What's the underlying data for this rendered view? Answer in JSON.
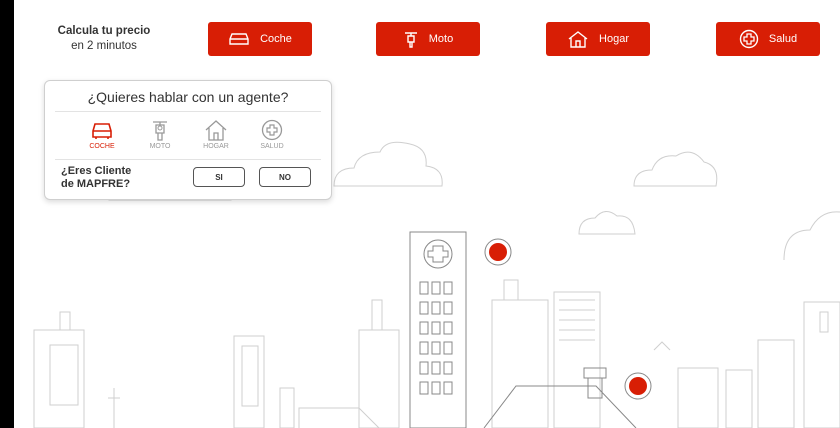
{
  "header": {
    "tagline_line1": "Calcula tu precio",
    "tagline_line2": "en 2 minutos",
    "buttons": [
      {
        "label": "Coche",
        "icon": "car-icon"
      },
      {
        "label": "Moto",
        "icon": "motorcycle-icon"
      },
      {
        "label": "Hogar",
        "icon": "house-icon"
      },
      {
        "label": "Salud",
        "icon": "health-cross-icon"
      }
    ]
  },
  "agent_panel": {
    "title": "¿Quieres hablar con un agente?",
    "products": [
      {
        "label": "COCHE",
        "icon": "car-icon",
        "active": true
      },
      {
        "label": "MOTO",
        "icon": "motorcycle-icon",
        "active": false
      },
      {
        "label": "HOGAR",
        "icon": "house-icon",
        "active": false
      },
      {
        "label": "SALUD",
        "icon": "health-cross-icon",
        "active": false
      }
    ],
    "client_question_line1": "¿Eres Cliente",
    "client_question_line2": "de MAPFRE?",
    "yes_label": "SI",
    "no_label": "NO"
  },
  "colors": {
    "brand_red": "#d81e05",
    "inactive_gray": "#999999",
    "line_gray": "#cccccc"
  }
}
